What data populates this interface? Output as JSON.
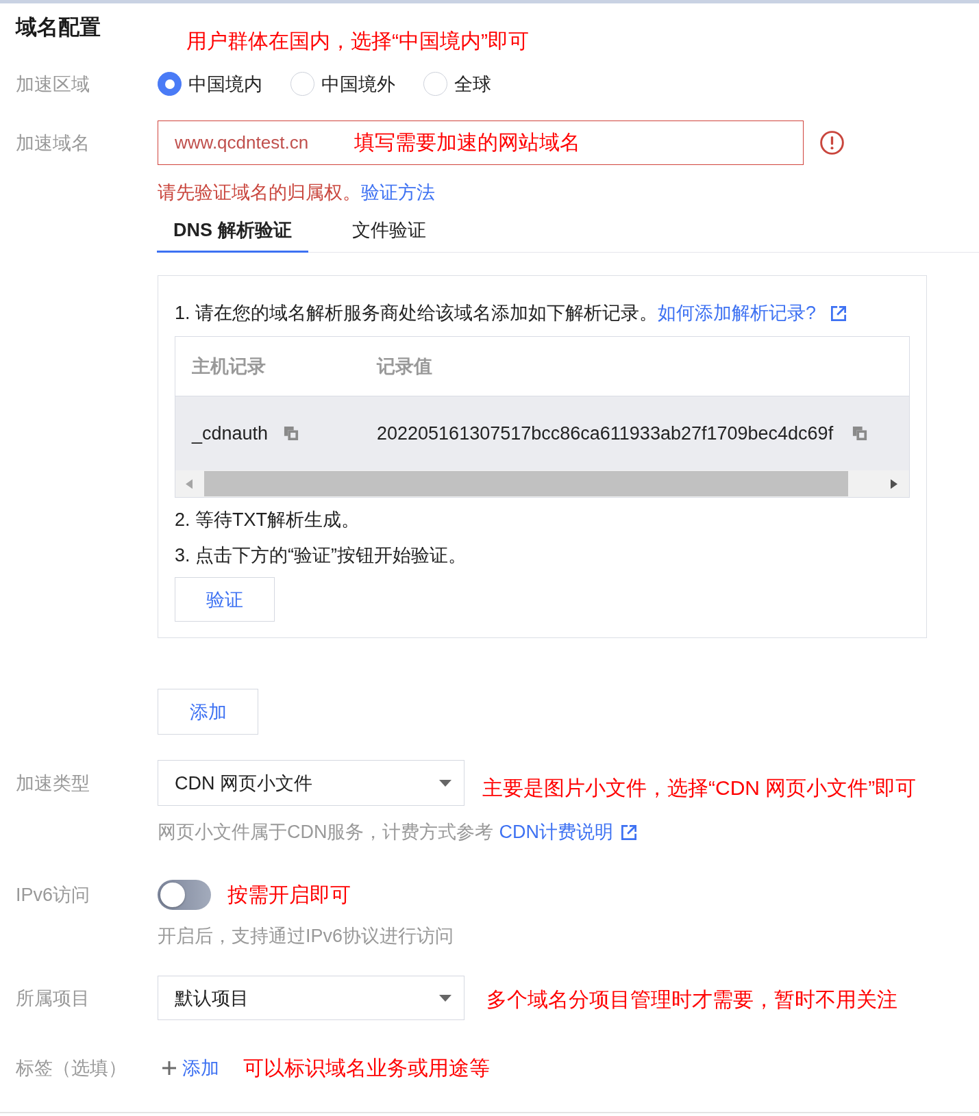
{
  "title": "域名配置",
  "title_annotation": "用户群体在国内，选择“中国境内”即可",
  "region": {
    "label": "加速区域",
    "options": [
      {
        "label": "中国境内",
        "selected": true
      },
      {
        "label": "中国境外",
        "selected": false
      },
      {
        "label": "全球",
        "selected": false
      }
    ]
  },
  "domain": {
    "label": "加速域名",
    "value": "www.qcdntest.cn",
    "annotation": "填写需要加速的网站域名",
    "error": true,
    "error_text": "请先验证域名的归属权。",
    "error_link": "验证方法"
  },
  "verify_tabs": [
    {
      "label": "DNS 解析验证",
      "selected": true
    },
    {
      "label": "文件验证",
      "selected": false
    }
  ],
  "dns_panel": {
    "intro": "1. 请在您的域名解析服务商处给该域名添加如下解析记录。",
    "intro_link": "如何添加解析记录?",
    "table": {
      "columns": [
        "主机记录",
        "记录值"
      ],
      "rows": [
        {
          "cells": [
            "_cdnauth",
            "202205161307517bcc86ca611933ab27f1709bec4dc69f"
          ]
        }
      ]
    },
    "steps": [
      "2. 等待TXT解析生成。",
      "3. 点击下方的“验证”按钮开始验证。"
    ],
    "verify_button": "验证"
  },
  "add_button": "添加",
  "acceleration_type": {
    "label": "加速类型",
    "value": "CDN 网页小文件",
    "annotation": "主要是图片小文件，选择“CDN 网页小文件”即可",
    "help": "网页小文件属于CDN服务，计费方式参考",
    "help_link": "CDN计费说明"
  },
  "ipv6": {
    "label": "IPv6访问",
    "on": false,
    "annotation": "按需开启即可",
    "help": "开启后，支持通过IPv6协议进行访问"
  },
  "project": {
    "label": "所属项目",
    "value": "默认项目",
    "annotation": "多个域名分项目管理时才需要，暂时不用关注"
  },
  "tags": {
    "label": "标签（选填）",
    "add_link": "添加",
    "annotation": "可以标识域名业务或用途等"
  }
}
